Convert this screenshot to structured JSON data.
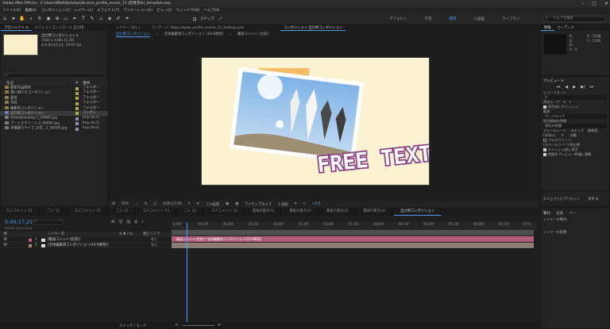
{
  "app": {
    "title": "Adobe After Effects - C:\\Users\\Midi\\Desktop\\dk-mun_profile_movie_11 (定員済み)_template.aep",
    "window_controls": [
      "–",
      "▢",
      "✕"
    ]
  },
  "menu": [
    "ファイル(F)",
    "編集(E)",
    "コンポジション(C)",
    "レイヤー(L)",
    "エフェクト(T)",
    "アニメーション(A)",
    "ビュー(V)",
    "ウィンドウ(W)",
    "ヘルプ(H)"
  ],
  "toolbar": {
    "snap_label": "スナップ",
    "workspaces": [
      "デフォルト",
      "学習",
      "標準",
      "小画面",
      "ライブラリ"
    ],
    "active_workspace": "標準",
    "help_search_placeholder": "ヘルプを検索"
  },
  "project_panel": {
    "tab_project": "プロジェクト ≡",
    "tab_effects": "エフェクトコントロール 出力用",
    "comp_name": "出力用コンポジション ▾",
    "comp_meta1": "1920 x 1080 (1.00)",
    "comp_meta2": "Δ 0;00;16;12, 29.97 fps",
    "col_name": "名前",
    "col_type": "種類",
    "items": [
      {
        "name": "最新作品素材",
        "type": "フォルダー",
        "color": "#b5a642",
        "icon": "folder-icon"
      },
      {
        "name": "選い避けるコンポジション",
        "type": "フォルダー",
        "color": "#b5a642",
        "icon": "folder-icon"
      },
      {
        "name": "素材",
        "type": "フォルダー",
        "color": "#b5a642",
        "icon": "folder-icon"
      },
      {
        "name": "平面",
        "type": "フォルダー",
        "color": "#b5a642",
        "icon": "folder-icon"
      },
      {
        "name": "編集用コンポジション",
        "type": "フォルダー",
        "color": "#b5a642",
        "icon": "folder-icon"
      },
      {
        "name": "出力用コンポジション",
        "type": "コンポジ",
        "color": "#b5a642",
        "icon": "composition-icon",
        "selected": true
      },
      {
        "name": "Slowdownding 2_00000.jpg",
        "type": "Imp.rte-G",
        "color": "#8a8fb8",
        "icon": "image-icon"
      },
      {
        "name": "ブートスクリーン 2_00000.jpg",
        "type": "Imp.rte-G",
        "color": "#8a8fb8",
        "icon": "image-icon"
      },
      {
        "name": "沖縄旅行ライブ_お気...2_00000.jpg",
        "type": "Imp.rte-G",
        "color": "#8a8fb8",
        "icon": "image-icon"
      }
    ]
  },
  "viewer": {
    "tab_layer": "レイヤー (なし)",
    "tab_footage": "フッテージ: https://www_profile_movie_11_footage.psd",
    "tab_comp": "コンポジション 出力用コンポジション",
    "crumbs": [
      "出力用コンポジション",
      "全体編集用コンポジション (16:9専用)",
      "動画コメント (名前)"
    ],
    "overlay_text": "FREE TEXT",
    "zoom": "25%",
    "timecode": "0;00;17;29",
    "resolution": "フル画質",
    "camera": "アクティブカメラ",
    "view": "1 画面",
    "plus_value": "+0.0"
  },
  "info_panel": {
    "tab_info": "情報",
    "tab_audio": "オーディオ",
    "r_label": "R :",
    "g_label": "G :",
    "b_label": "B :",
    "a_label": "A : 0",
    "x_label": "X : 1538",
    "y_label": "Y : 1295"
  },
  "preview_panel": {
    "title": "プレビュー ≡",
    "shortcut_label": "ショートカット",
    "shortcut_value": "0",
    "include_label": "再生ループ",
    "cache_label": "再生前にキャッシュ",
    "range_label": "範囲",
    "range_value": "ワークエリア",
    "play_from_label": "再生開始の時間",
    "play_from_value": "現在の時間",
    "framerate_label": "フレームレート",
    "skip_label": "スキップ",
    "resolution_label": "解像度",
    "framerate_value": "(30fps)",
    "skip_value": "0",
    "resolution_value": "自動",
    "fullscreen_label": "フルスクリーン",
    "stop_label": "(スペースバー) で停止時:",
    "option1": "キャッシュ前に再生",
    "option2": "時間をプレビュー時間に移動"
  },
  "right_lower": {
    "tab1": "エフェクトとプリセット",
    "tab2": "文字 ≡",
    "tab3": "整列",
    "tab4": "段落",
    "tab5": "オー",
    "layer_align": "レイヤーを整列:",
    "layer_distribute": "レイヤーを配置:"
  },
  "timeline": {
    "tabs": [
      "三人コメント 11",
      "二人 11",
      "三人コメント 12",
      "二人 13",
      "三人コメント 13",
      "二人 14",
      "三人コメント 14",
      "最後の集合(1)",
      "最後の集合(2)",
      "最後の集合(3)",
      "最後の集合(4)",
      "出力用コンポジション"
    ],
    "active_tab": "出力用コンポジション",
    "timecode": "0;00;17;29",
    "timecode_sub": "00539 (29.97 fps)",
    "col_layer": "レイヤー名",
    "col_parent": "親とリンク",
    "layers": [
      {
        "num": "1",
        "name": "[動画コメント(名前)]",
        "color": "#c45a7e",
        "parent": "なし"
      },
      {
        "num": "2",
        "name": "[全体編集用コンポジション(16:9専用)]",
        "color": "#9a8a7a",
        "parent": "なし"
      }
    ],
    "clip1_label": "動画コメント(名前) / 全体編集用コンポジション(16:9専用)",
    "ruler": [
      "0;00f",
      "00;15f",
      "01;00f",
      "01;15f",
      "02;00f",
      "02;15f",
      "03;00f",
      "03;15f",
      "04;00f",
      "04;15f",
      "05;00f",
      "05;15f",
      "06;00f",
      "06;15f",
      "07;0"
    ],
    "bottom_label": "スイッチ / モード"
  }
}
